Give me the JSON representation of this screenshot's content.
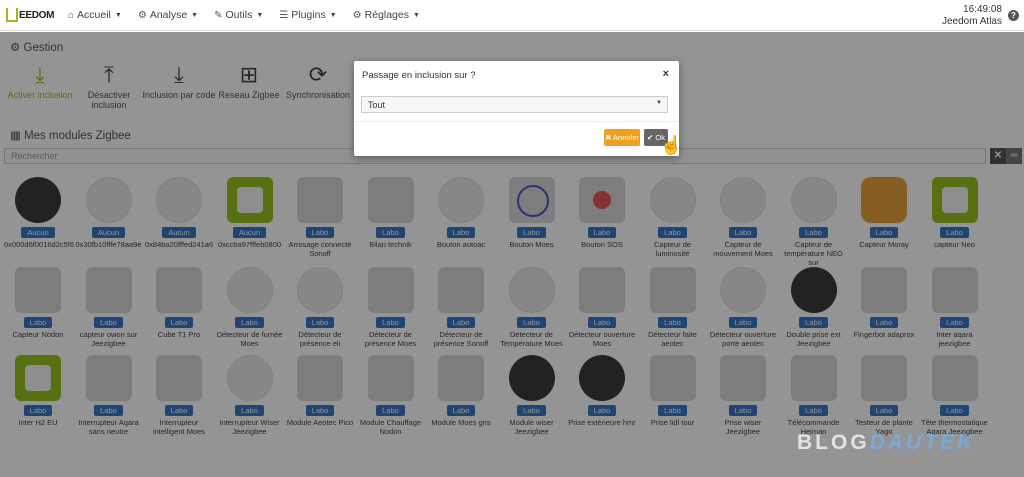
{
  "navbar": {
    "logo_text": "EEDOM",
    "menu": [
      {
        "label": "Accueil",
        "icon": "home-icon",
        "glyph": "⌂"
      },
      {
        "label": "Analyse",
        "icon": "chart-icon",
        "glyph": "⚙"
      },
      {
        "label": "Outils",
        "icon": "wrench-icon",
        "glyph": "✎"
      },
      {
        "label": "Plugins",
        "icon": "list-icon",
        "glyph": "☰"
      },
      {
        "label": "Réglages",
        "icon": "cogs-icon",
        "glyph": "⚙"
      }
    ],
    "time": "16:49:08",
    "subtitle": "Jeedom Atlas",
    "help_glyph": "?"
  },
  "gestion": {
    "title": "Gestion",
    "actions": [
      {
        "label": "Activer inclusion",
        "glyph": "⤓",
        "color": "#94c11f"
      },
      {
        "label": "Désactiver inclusion",
        "glyph": "⤒"
      },
      {
        "label": "Inclusion par code",
        "glyph": "⤓"
      },
      {
        "label": "Reseau Zigbee",
        "glyph": "⊞"
      },
      {
        "label": "Synchronisation",
        "glyph": "⟳"
      }
    ]
  },
  "modules": {
    "title": "Mes modules Zigbee",
    "search_placeholder": "Rechercher"
  },
  "cards_row1": [
    {
      "badge": "Aucun",
      "name": "0x000d6f0016d2c5f6"
    },
    {
      "badge": "Aucun",
      "name": "0x30fb10fffe78aa9e"
    },
    {
      "badge": "Aucun",
      "name": "0x84ba20fffed241a6"
    },
    {
      "badge": "Aucun",
      "name": "0xccba97fffeb0800"
    },
    {
      "badge": "Labo",
      "name": "Arrosage connecté Sonoff"
    },
    {
      "badge": "Labo",
      "name": "Bilan technik"
    },
    {
      "badge": "Labo",
      "name": "Bouton aotoac"
    },
    {
      "badge": "Labo",
      "name": "Bouton Moes"
    },
    {
      "badge": "Labo",
      "name": "Bouton SOS"
    },
    {
      "badge": "Labo",
      "name": "Capteur de luminosité"
    },
    {
      "badge": "Labo",
      "name": "Capteur de mouvement Moes"
    },
    {
      "badge": "Labo",
      "name": "Capteur de température NEO sur"
    },
    {
      "badge": "Labo",
      "name": "Capteur Moray"
    },
    {
      "badge": "Labo",
      "name": "capteur Neo"
    }
  ],
  "cards_row2": [
    {
      "badge": "Labo",
      "name": "Capteur Nodon"
    },
    {
      "badge": "Labo",
      "name": "capteur owon sur Jeezigbee"
    },
    {
      "badge": "Labo",
      "name": "Cube T1 Pro"
    },
    {
      "badge": "Labo",
      "name": "Détecteur de fumée Moes"
    },
    {
      "badge": "Labo",
      "name": "Détecteur de présence eli"
    },
    {
      "badge": "Labo",
      "name": "Détecteur de présence Moes"
    },
    {
      "badge": "Labo",
      "name": "Détecteur de présence Sonoff"
    },
    {
      "badge": "Labo",
      "name": "Détecteur de Température Moes"
    },
    {
      "badge": "Labo",
      "name": "Détecteur ouverture Moes"
    },
    {
      "badge": "Labo",
      "name": "Détecteur faite aeotec"
    },
    {
      "badge": "Labo",
      "name": "Détecteur ouverture porte aeotec"
    },
    {
      "badge": "Labo",
      "name": "Double prise ext Jeezigbee"
    },
    {
      "badge": "Labo",
      "name": "Fingerbot adaprox"
    },
    {
      "badge": "Labo",
      "name": "Inter aqara jeezigbee"
    }
  ],
  "cards_row3": [
    {
      "badge": "Labo",
      "name": "Inter H2 EU"
    },
    {
      "badge": "Labo",
      "name": "Interrupteur Aqara sans neutre"
    },
    {
      "badge": "Labo",
      "name": "Interrupteur intelligent Moes"
    },
    {
      "badge": "Labo",
      "name": "Interrupteur Wiser Jeezigbee"
    },
    {
      "badge": "Labo",
      "name": "Module Aeotec Pico"
    },
    {
      "badge": "Labo",
      "name": "Module Chauffage Nodon"
    },
    {
      "badge": "Labo",
      "name": "Module Moes gris"
    },
    {
      "badge": "Labo",
      "name": "Module wiser Jeezigbee"
    },
    {
      "badge": "Labo",
      "name": "Prise extérieure hmr"
    },
    {
      "badge": "Labo",
      "name": "Prise lidl tour"
    },
    {
      "badge": "Labo",
      "name": "Prise wiser Jeezigbee"
    },
    {
      "badge": "Labo",
      "name": "Télécommande Heiman"
    },
    {
      "badge": "Labo",
      "name": "Testeur de plante Yago"
    },
    {
      "badge": "Labo",
      "name": "Tête thermostatique Aqara Jeezigbee"
    }
  ],
  "modal": {
    "title": "Passage en inclusion sur ?",
    "close_glyph": "×",
    "select_value": "Tout",
    "cancel_label": "✖ Annuler",
    "ok_label": "✔ Ok"
  },
  "watermark": {
    "part1": "BLOG",
    "part2": "DAUTEK"
  },
  "colors": {
    "accent": "#94c11f",
    "badge": "#3a77c7",
    "cancel": "#f0a020",
    "ok": "#666666"
  }
}
